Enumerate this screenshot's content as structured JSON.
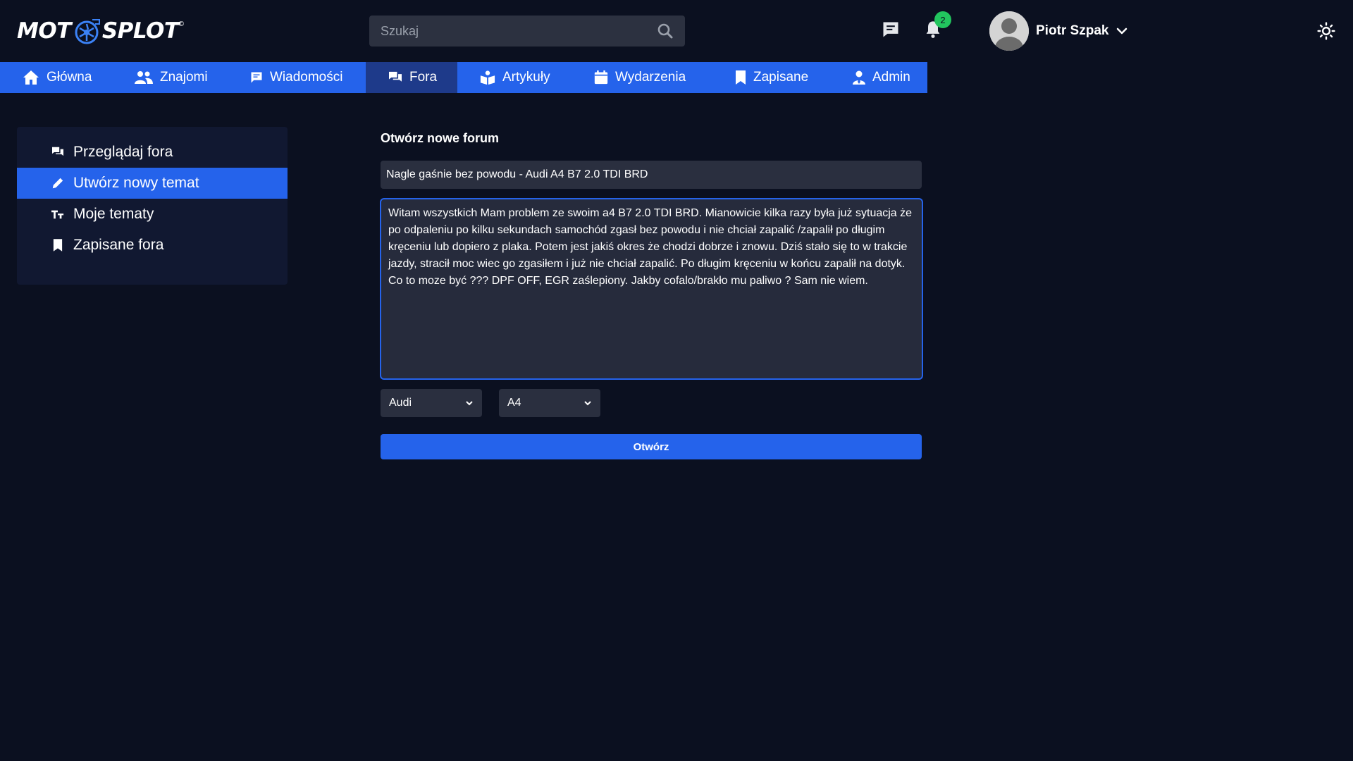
{
  "brand": {
    "logo_text_left": "MOT",
    "logo_text_right": "SPLOT",
    "logo_mark": "©"
  },
  "search": {
    "placeholder": "Szukaj",
    "value": ""
  },
  "notifications": {
    "count": "2"
  },
  "user": {
    "name": "Piotr Szpak"
  },
  "nav": {
    "items": [
      {
        "label": "Główna",
        "icon": "home-icon"
      },
      {
        "label": "Znajomi",
        "icon": "friends-icon"
      },
      {
        "label": "Wiadomości",
        "icon": "message-icon"
      },
      {
        "label": "Fora",
        "icon": "forum-icon",
        "active": true
      },
      {
        "label": "Artykuły",
        "icon": "articles-icon"
      },
      {
        "label": "Wydarzenia",
        "icon": "calendar-icon"
      },
      {
        "label": "Zapisane",
        "icon": "bookmark-icon"
      },
      {
        "label": "Admin",
        "icon": "admin-icon"
      }
    ]
  },
  "sidebar": {
    "items": [
      {
        "label": "Przeglądaj fora",
        "icon": "forum-icon"
      },
      {
        "label": "Utwórz nowy temat",
        "icon": "pencil-icon",
        "active": true
      },
      {
        "label": "Moje tematy",
        "icon": "text-icon"
      },
      {
        "label": "Zapisane fora",
        "icon": "bookmark-icon"
      }
    ]
  },
  "form": {
    "title": "Otwórz nowe forum",
    "topic_value": "Nagle gaśnie bez powodu - Audi A4 B7 2.0 TDI BRD",
    "content_value": "Witam wszystkich Mam problem ze swoim a4 B7 2.0 TDI BRD. Mianowicie kilka razy była już sytuacja że po odpaleniu po kilku sekundach samochód zgasł bez powodu i nie chciał zapalić /zapalił po długim kręceniu lub dopiero z plaka. Potem jest jakiś okres że chodzi dobrze i znowu. Dziś stało się to w trakcie jazdy, stracił moc wiec go zgasiłem i już nie chciał zapalić. Po długim kręceniu w końcu zapalił na dotyk. Co to moze być ??? DPF OFF, EGR zaślepiony. Jakby cofalo/brakło mu paliwo ? Sam nie wiem.\n",
    "brand_select": "Audi",
    "model_select": "A4",
    "submit_label": "Otwórz"
  },
  "colors": {
    "background": "#0b1020",
    "accent": "#2563eb",
    "nav_active": "#1e3a8a",
    "badge": "#22c55e"
  }
}
